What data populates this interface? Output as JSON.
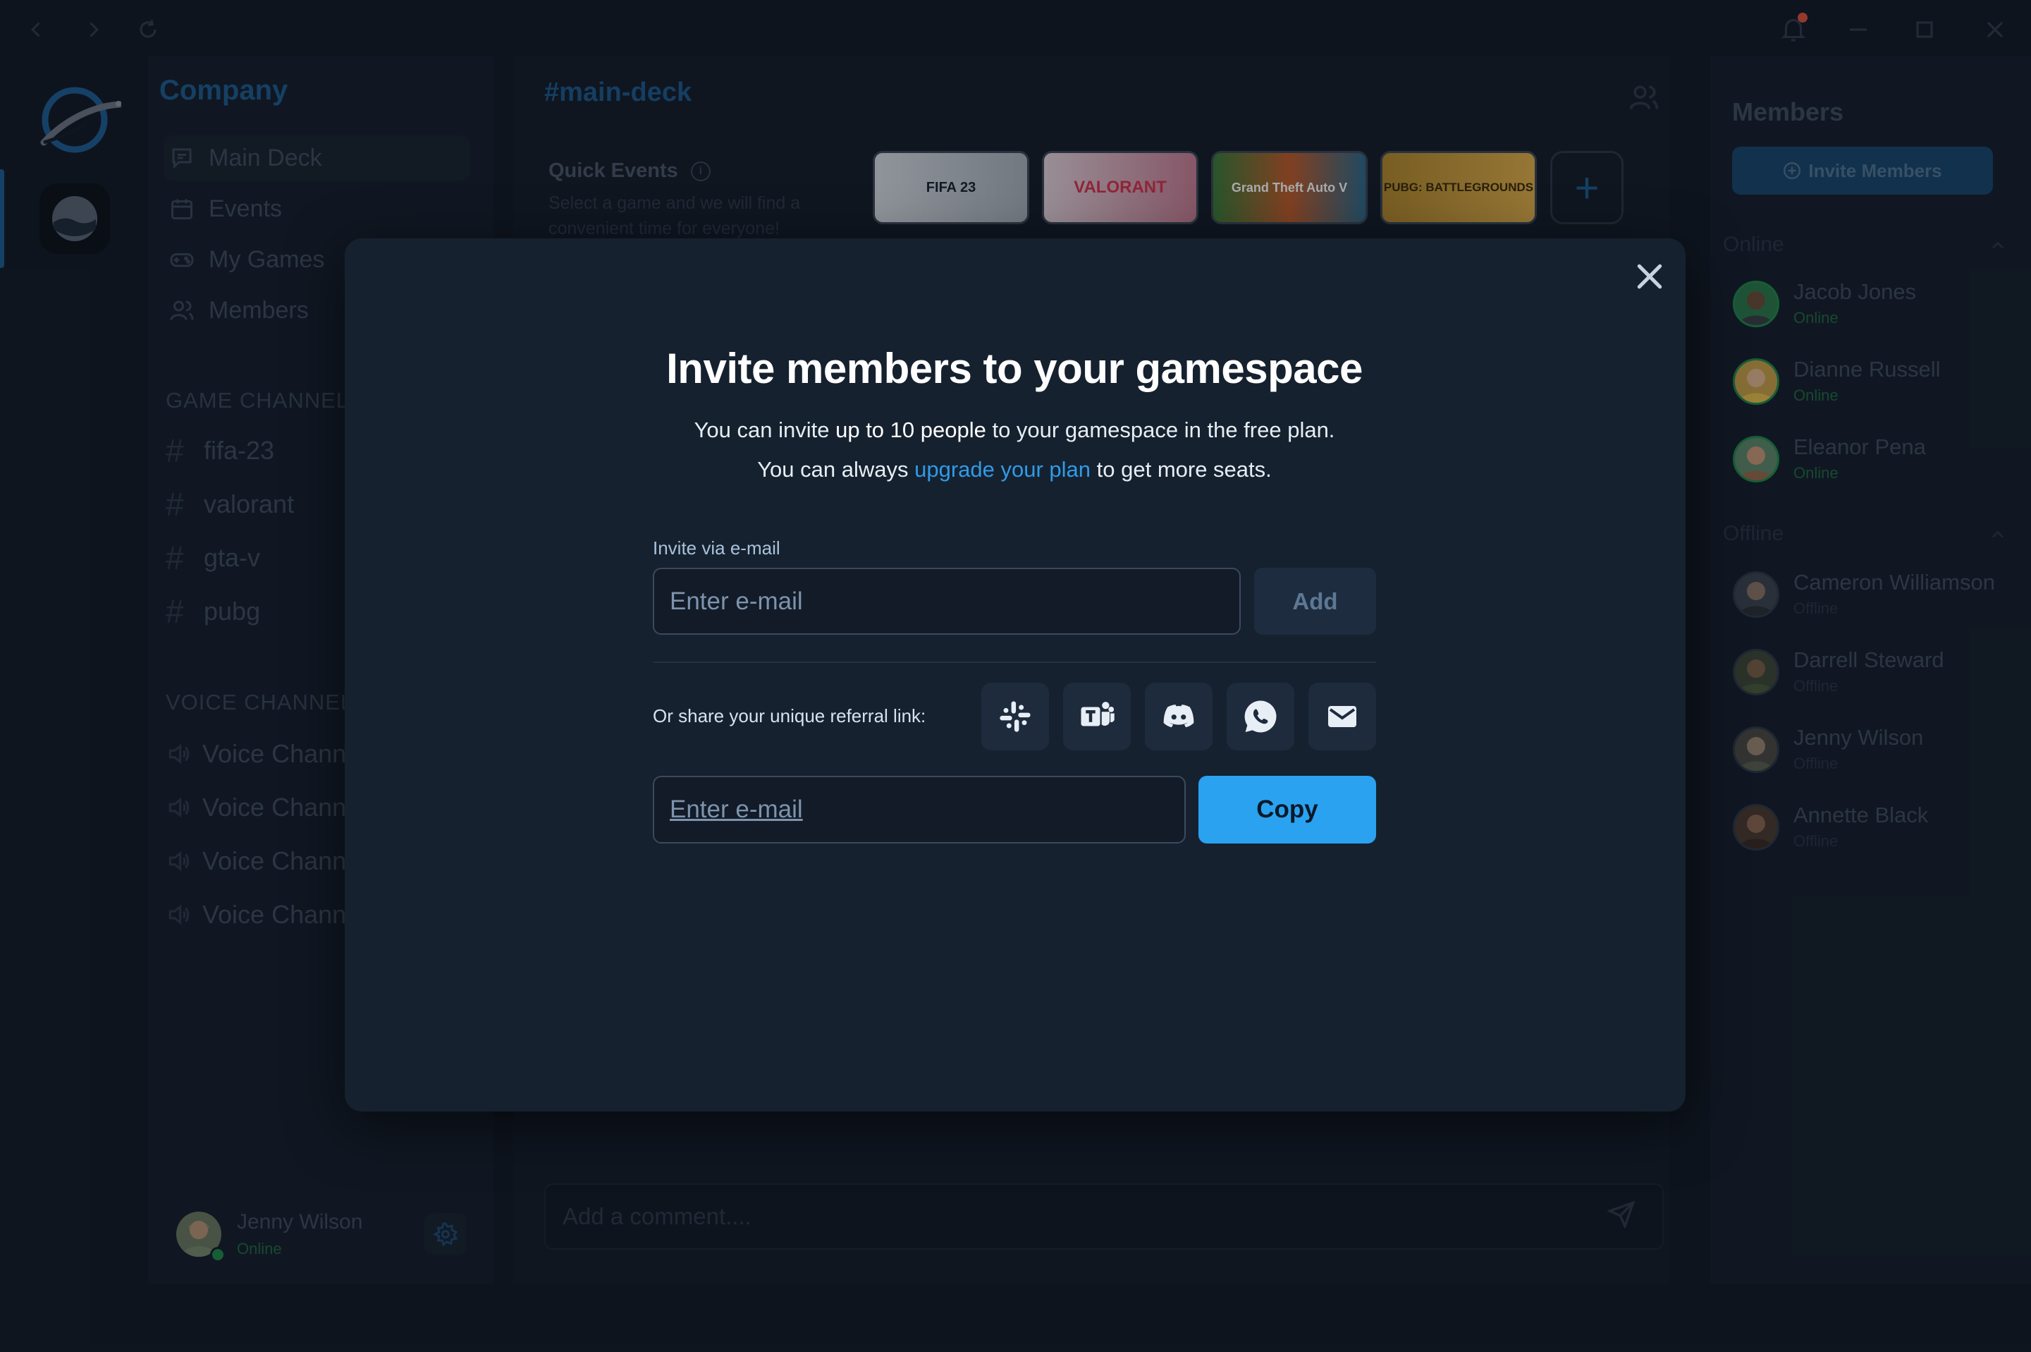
{
  "sidebar": {
    "workspace": "Company",
    "nav": [
      {
        "label": "Main Deck",
        "icon": "message-square-icon"
      },
      {
        "label": "Events",
        "icon": "calendar-icon"
      },
      {
        "label": "My Games",
        "icon": "gamepad-icon"
      },
      {
        "label": "Members",
        "icon": "users-icon"
      }
    ],
    "game_channels_heading": "GAME CHANNELS",
    "game_channels": [
      "fifa-23",
      "valorant",
      "gta-v",
      "pubg"
    ],
    "voice_channels_heading": "VOICE CHANNELS",
    "voice_channels": [
      "Voice Channel",
      "Voice Channel",
      "Voice Channel",
      "Voice Channel"
    ],
    "current_user": {
      "name": "Jenny Wilson",
      "status": "Online"
    }
  },
  "main": {
    "channel_title": "#main-deck",
    "quick_events": {
      "title": "Quick Events",
      "subtitle": "Select a game and we will find a convenient time for everyone!",
      "games": [
        "FIFA 23",
        "VALORANT",
        "Grand Theft Auto V",
        "PUBG: BATTLEGROUNDS"
      ]
    },
    "comment_placeholder": "Add a comment...."
  },
  "members_panel": {
    "title": "Members",
    "invite_label": "Invite Members",
    "online_heading": "Online",
    "offline_heading": "Offline",
    "online": [
      {
        "name": "Jacob Jones",
        "status": "Online"
      },
      {
        "name": "Dianne Russell",
        "status": "Online"
      },
      {
        "name": "Eleanor Pena",
        "status": "Online"
      }
    ],
    "offline": [
      {
        "name": "Cameron Williamson",
        "status": "Offline"
      },
      {
        "name": "Darrell Steward",
        "status": "Offline"
      },
      {
        "name": "Jenny Wilson",
        "status": "Offline"
      },
      {
        "name": "Annette Black",
        "status": "Offline"
      }
    ]
  },
  "modal": {
    "heading": "Invite members to your gamespace",
    "line1_pre": "You can invite ",
    "line1_bold": "up to 10 people",
    "line1_post": " to your gamespace in the free plan.",
    "line2_pre": "You can always ",
    "line2_link": "upgrade your plan",
    "line2_post": " to get more seats.",
    "email_label": "Invite via e-mail",
    "email_placeholder": "Enter e-mail",
    "add_label": "Add",
    "share_label": "Or share your unique referral link:",
    "share_targets": [
      "slack-icon",
      "teams-icon",
      "discord-icon",
      "whatsapp-icon",
      "mail-icon"
    ],
    "referral_value": "Enter e-mail",
    "copy_label": "Copy"
  },
  "colors": {
    "accent": "#2aa2f0",
    "link": "#2f9be8",
    "online": "#1f8a4c",
    "modal_bg": "#16212f"
  }
}
